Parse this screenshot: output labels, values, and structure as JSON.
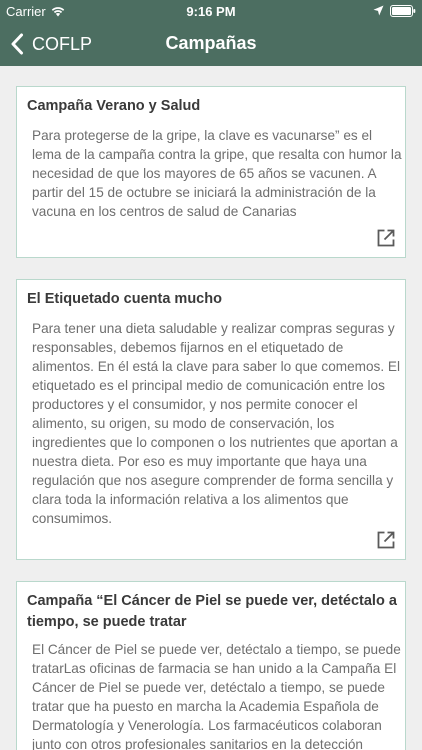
{
  "status_bar": {
    "carrier": "Carrier",
    "time": "9:16 PM"
  },
  "nav": {
    "back_label": "COFLP",
    "title": "Campañas"
  },
  "campaigns": [
    {
      "title": "Campaña Verano y Salud",
      "body": "Para protegerse de la gripe, la clave es vacunarse” es el lema de la campaña contra la gripe, que resalta con humor la necesidad de que los mayores de 65 años se vacunen. A partir del 15 de octubre se iniciará la administración de la vacuna en los centros de salud de Canarias"
    },
    {
      "title": "El Etiquetado cuenta mucho",
      "body": "Para tener una dieta saludable y realizar compras seguras y responsables, debemos fijarnos en el etiquetado de alimentos. En él está la clave para saber lo que comemos. El etiquetado es el principal medio de comunicación entre los productores y el consumidor, y nos permite conocer el alimento, su origen, su modo de conservación, los ingredientes que lo componen o los nutrientes que aportan a nuestra dieta. Por eso es muy importante que haya una regulación que nos asegure comprender de forma sencilla y clara toda la información relativa a los alimentos que consumimos."
    },
    {
      "title": "Campaña “El Cáncer de Piel se puede ver, detéctalo a tiempo, se puede tratar",
      "body": "El Cáncer de Piel se puede ver, detéctalo a tiempo, se puede tratarLas oficinas de farmacia se han unido a la Campaña El Cáncer de Piel se puede ver, detéctalo a tiempo, se puede tratar que ha puesto en marcha la Academia Española de Dermatología y Venerología. Los farmacéuticos colaboran junto con otros profesionales sanitarios en la detección"
    }
  ],
  "colors": {
    "header_bg": "#4c6e61",
    "card_border": "#b9d8cc",
    "page_bg": "#efefef"
  },
  "icons": [
    "wifi-icon",
    "location-icon",
    "battery-icon",
    "back-chevron-icon",
    "open-external-icon"
  ]
}
